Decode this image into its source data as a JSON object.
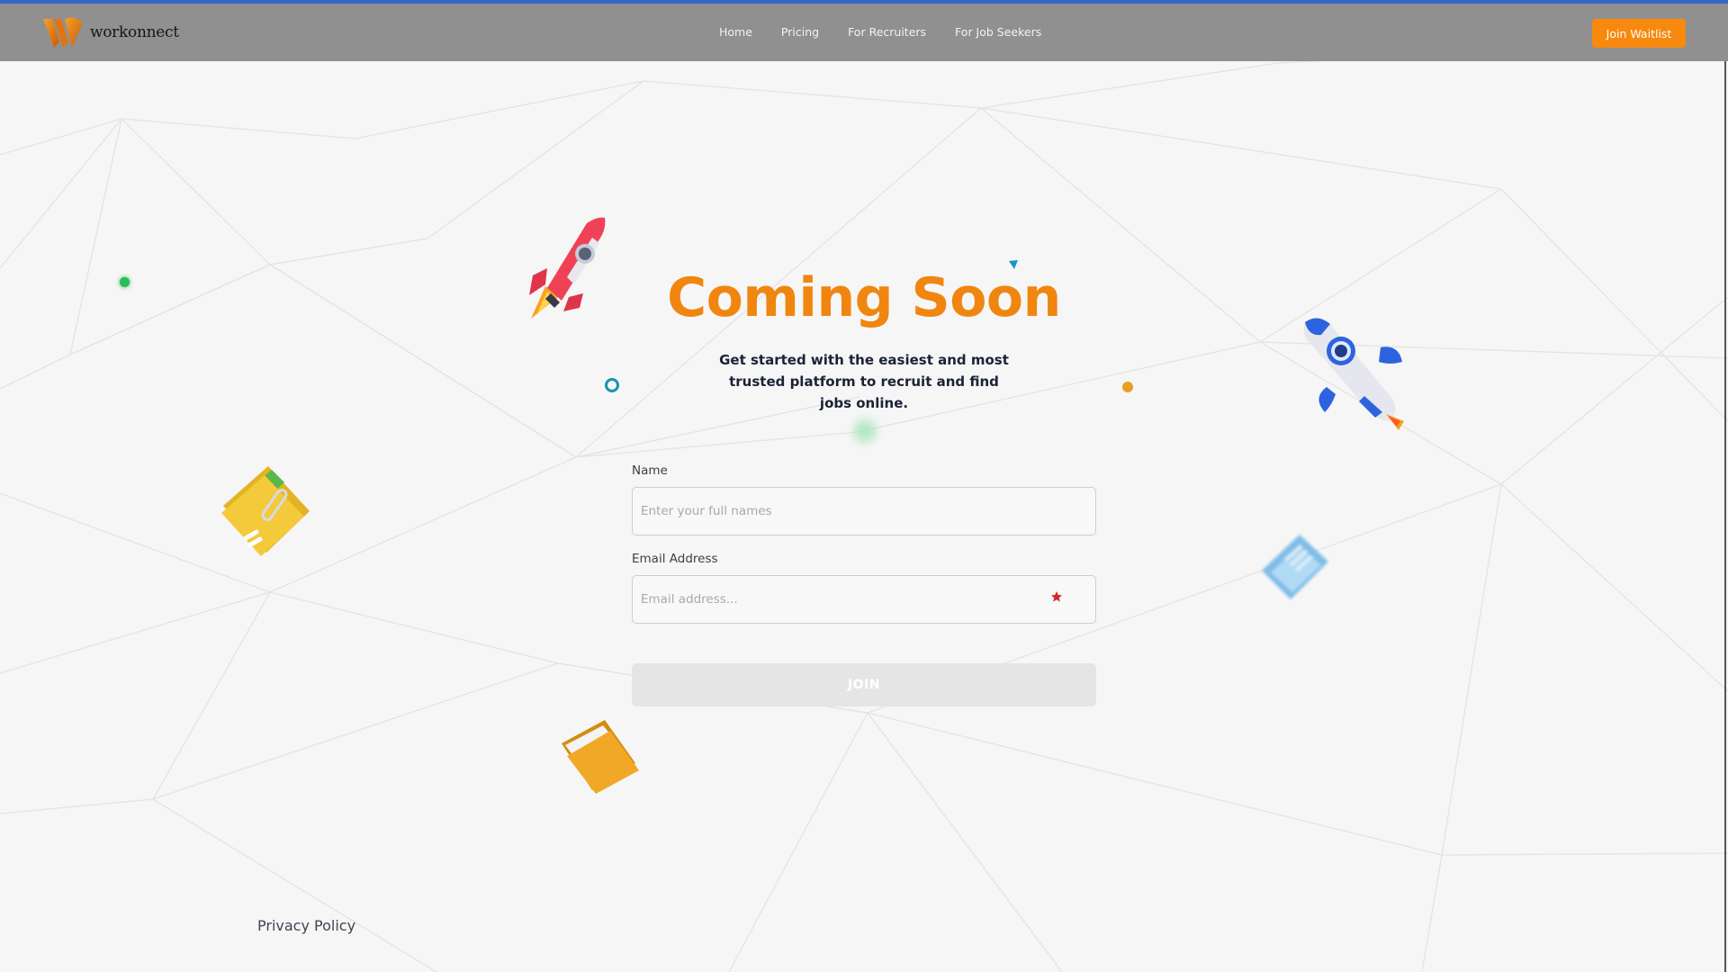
{
  "header": {
    "brand": "workonnect",
    "nav": [
      "Home",
      "Pricing",
      "For Recruiters",
      "For Job Seekers"
    ],
    "cta_label": "Join Waitlist"
  },
  "hero": {
    "title": "Coming Soon",
    "subtitle": "Get started with the easiest and most trusted platform to recruit and find jobs online."
  },
  "form": {
    "name_label": "Name",
    "name_placeholder": "Enter your full names",
    "email_label": "Email Address",
    "email_placeholder": "Email address...",
    "submit_label": "JOIN"
  },
  "footer": {
    "privacy_label": "Privacy Policy"
  },
  "colors": {
    "accent": "#f7890e",
    "title": "#f0860f",
    "navbar": "#909090",
    "top_line": "#3a64c8"
  },
  "decorations": [
    "red-rocket-icon",
    "blue-rocket-icon",
    "yellow-folder-icon",
    "orange-folder-icon",
    "blue-document-icon"
  ]
}
